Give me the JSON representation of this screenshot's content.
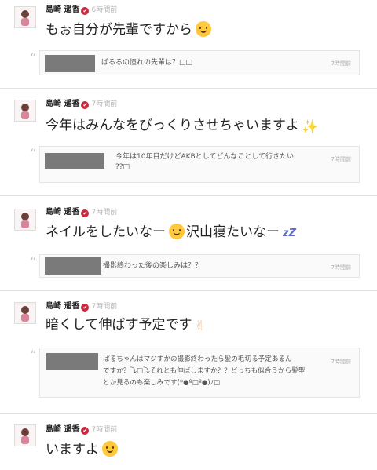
{
  "posts": [
    {
      "author": "島崎 遥香",
      "time": "6時間前",
      "message": "もぉ自分が先輩ですから",
      "emoji": "smiling-face-emoji",
      "question": "ぱるるの憧れの先輩は？□□",
      "question_time": "7時間前"
    },
    {
      "author": "島崎 遥香",
      "time": "7時間前",
      "message": "今年はみんなをびっくりさせちゃいますよ",
      "emoji": "sparkles-emoji",
      "emoji_glyph": "✨",
      "question_line1": "今年は10年目だけどAKBとしてどんなことして行きたい",
      "question_line2": "??□",
      "question_time": "7時間前"
    },
    {
      "author": "島崎 遥香",
      "time": "7時間前",
      "message_a": "ネイルをしたいなー",
      "message_b": "沢山寝たいなー",
      "emoji_a": "smiling-face-emoji",
      "emoji_b": "zzz-emoji",
      "emoji_b_glyph": "💤",
      "question": "撮影終わった後の楽しみは？？",
      "question_time": "7時間前"
    },
    {
      "author": "島崎 遥香",
      "time": "7時間前",
      "message": "暗くして伸ばす予定です",
      "emoji": "victory-hand-emoji",
      "emoji_glyph": "✌",
      "question_line1": "ぱるちゃんはマジすかの撮影終わったら髪の毛切る予定あるん",
      "question_line2": "ですか？⤵□⤵それとも伸ばしますか？？どっちも似合うから髪型",
      "question_line3": "とか見るのも楽しみです(*●º□º●)ﾉ□",
      "question_time": "7時間前"
    },
    {
      "author": "島崎 遥香",
      "time": "7時間前",
      "message": "いますよ",
      "emoji": "smiling-face-emoji"
    }
  ],
  "colors": {
    "verified_badge": "#c9283e",
    "redaction": "#7a7a7a",
    "divider": "#e2e2e2"
  }
}
